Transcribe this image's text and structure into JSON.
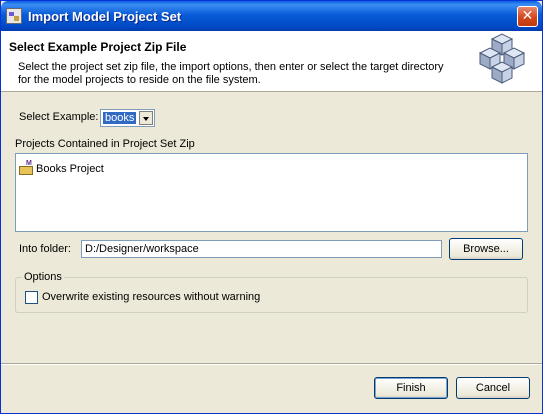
{
  "window": {
    "title": "Import Model Project Set",
    "close_icon": "close-icon"
  },
  "header": {
    "title": "Select Example Project Zip File",
    "description": "Select the project set zip file, the import options, then enter or select the target directory for the model projects to reside on the file system."
  },
  "example": {
    "label": "Select Example:",
    "value": "books"
  },
  "projects": {
    "label": "Projects Contained in Project Set Zip",
    "items": [
      "Books Project"
    ]
  },
  "folder": {
    "label": "Into folder:",
    "value": "D:/Designer/workspace",
    "browse_label": "Browse..."
  },
  "options": {
    "legend": "Options",
    "overwrite_label": "Overwrite existing resources without warning",
    "overwrite_checked": false
  },
  "footer": {
    "finish_label": "Finish",
    "cancel_label": "Cancel"
  },
  "colors": {
    "titlebar": "#0a5cd8",
    "selection": "#316ac5",
    "dialog_bg": "#ece9d8"
  }
}
